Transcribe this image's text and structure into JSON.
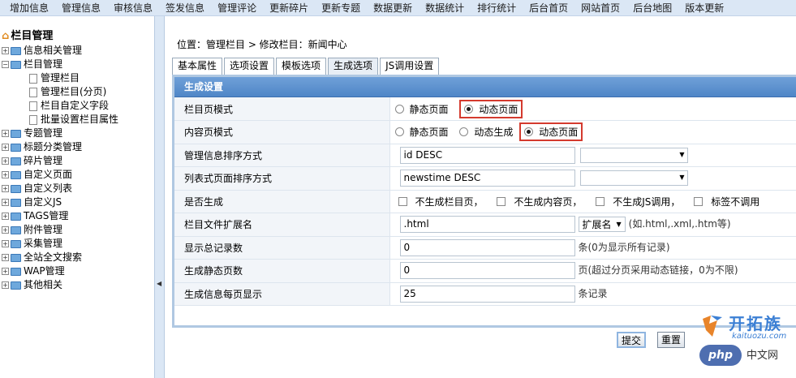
{
  "topnav": [
    "增加信息",
    "管理信息",
    "审核信息",
    "签发信息",
    "管理评论",
    "更新碎片",
    "更新专题",
    "数据更新",
    "数据统计",
    "排行统计",
    "后台首页",
    "网站首页",
    "后台地图",
    "版本更新"
  ],
  "sidebar": {
    "title": "栏目管理",
    "nodes": [
      {
        "label": "信息相关管理",
        "kind": "folder",
        "pm": "+",
        "level": 0
      },
      {
        "label": "栏目管理",
        "kind": "folder",
        "pm": "−",
        "level": 0
      },
      {
        "label": "管理栏目",
        "kind": "doc",
        "level": 1
      },
      {
        "label": "管理栏目(分页)",
        "kind": "doc",
        "level": 1
      },
      {
        "label": "栏目自定义字段",
        "kind": "doc",
        "level": 1
      },
      {
        "label": "批量设置栏目属性",
        "kind": "doc",
        "level": 1
      },
      {
        "label": "专题管理",
        "kind": "folder",
        "pm": "+",
        "level": 0
      },
      {
        "label": "标题分类管理",
        "kind": "folder",
        "pm": "+",
        "level": 0
      },
      {
        "label": "碎片管理",
        "kind": "folder",
        "pm": "+",
        "level": 0
      },
      {
        "label": "自定义页面",
        "kind": "folder",
        "pm": "+",
        "level": 0
      },
      {
        "label": "自定义列表",
        "kind": "folder",
        "pm": "+",
        "level": 0
      },
      {
        "label": "自定义JS",
        "kind": "folder",
        "pm": "+",
        "level": 0
      },
      {
        "label": "TAGS管理",
        "kind": "folder",
        "pm": "+",
        "level": 0
      },
      {
        "label": "附件管理",
        "kind": "folder",
        "pm": "+",
        "level": 0
      },
      {
        "label": "采集管理",
        "kind": "folder",
        "pm": "+",
        "level": 0
      },
      {
        "label": "全站全文搜索",
        "kind": "folder",
        "pm": "+",
        "level": 0
      },
      {
        "label": "WAP管理",
        "kind": "folder",
        "pm": "+",
        "level": 0
      },
      {
        "label": "其他相关",
        "kind": "folder",
        "pm": "+",
        "level": 0
      }
    ]
  },
  "location": "位置：管理栏目 > 修改栏目：新闻中心",
  "tabs": [
    "基本属性",
    "选项设置",
    "模板选项",
    "生成选项",
    "JS调用设置"
  ],
  "active_tab": 3,
  "panel": {
    "header": "生成设置",
    "rows": {
      "list_mode": {
        "label": "栏目页模式",
        "opt1": "静态页面",
        "opt2": "动态页面"
      },
      "content_mode": {
        "label": "内容页模式",
        "opt1": "静态页面",
        "opt2": "动态生成",
        "opt3": "动态页面"
      },
      "sort": {
        "label": "管理信息排序方式",
        "value": "id DESC"
      },
      "list_sort": {
        "label": "列表式页面排序方式",
        "value": "newstime DESC"
      },
      "generate": {
        "label": "是否生成",
        "c1": "不生成栏目页，",
        "c2": "不生成内容页，",
        "c3": "不生成JS调用，",
        "c4": "标签不调用"
      },
      "ext": {
        "label": "栏目文件扩展名",
        "value": ".html",
        "select": "扩展名",
        "note": "(如.html,.xml,.htm等)"
      },
      "total": {
        "label": "显示总记录数",
        "value": "0",
        "note": "条(0为显示所有记录)"
      },
      "pages": {
        "label": "生成静态页数",
        "value": "0",
        "note": "页(超过分页采用动态链接，0为不限)"
      },
      "perpage": {
        "label": "生成信息每页显示",
        "value": "25",
        "note": "条记录"
      }
    }
  },
  "buttons": {
    "submit": "提交",
    "reset": "重置"
  },
  "watermark": {
    "name": "开拓族",
    "domain": "kaituozu.com",
    "php": "php",
    "cn": "中文网"
  },
  "colors": {
    "highlight": "#d43a2e",
    "header": "#4f86c7",
    "nav_bg": "#dbe7f5"
  }
}
